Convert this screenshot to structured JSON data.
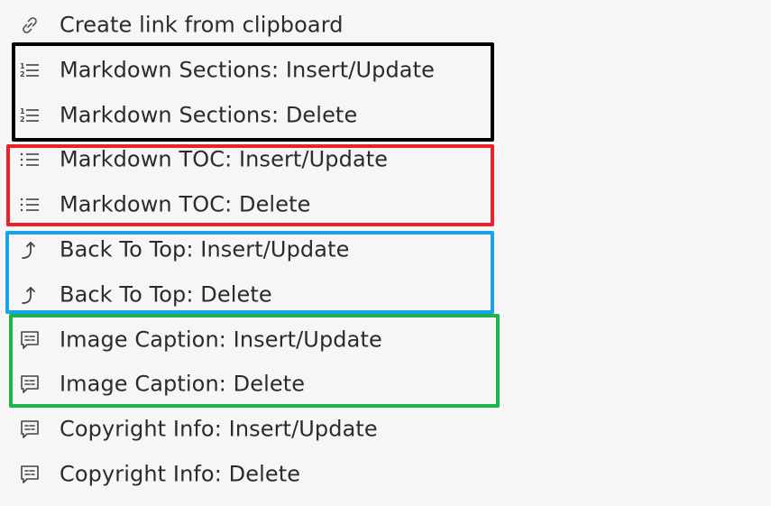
{
  "menu": {
    "items": [
      {
        "label": "Create link from clipboard",
        "icon": "link-icon"
      },
      {
        "label": "Markdown Sections: Insert/Update",
        "icon": "numbered-list-icon"
      },
      {
        "label": "Markdown Sections: Delete",
        "icon": "numbered-list-icon"
      },
      {
        "label": "Markdown TOC: Insert/Update",
        "icon": "bullet-list-icon"
      },
      {
        "label": "Markdown TOC: Delete",
        "icon": "bullet-list-icon"
      },
      {
        "label": "Back To Top: Insert/Update",
        "icon": "arrow-up-turn-icon"
      },
      {
        "label": "Back To Top: Delete",
        "icon": "arrow-up-turn-icon"
      },
      {
        "label": "Image Caption: Insert/Update",
        "icon": "caption-icon"
      },
      {
        "label": "Image Caption: Delete",
        "icon": "caption-icon"
      },
      {
        "label": "Copyright Info: Insert/Update",
        "icon": "caption-icon"
      },
      {
        "label": "Copyright Info: Delete",
        "icon": "caption-icon"
      }
    ]
  },
  "highlights": {
    "colors": {
      "sections": "#000000",
      "toc": "#e8212b",
      "back_to_top": "#1aa3e6",
      "image_caption": "#1fb24a"
    }
  }
}
